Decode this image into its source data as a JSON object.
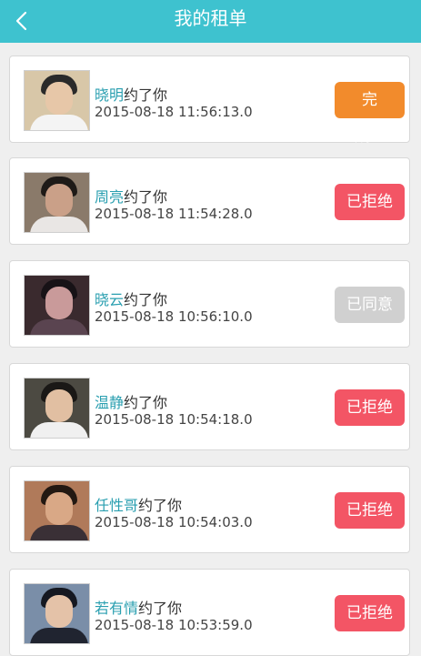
{
  "header": {
    "title": "我的租单"
  },
  "icons": {
    "back": "chevron-left-icon"
  },
  "colors": {
    "header_bg": "#3ec2cf",
    "name_text": "#2a9fb0",
    "done_button": "#f28b2c",
    "reject_button": "#f35565",
    "agree_button": "#d0d0d0"
  },
  "orders": [
    {
      "name": "晓明",
      "suffix": "约了你",
      "time": "2015-08-18 11:56:13.0",
      "status": "完成",
      "status_type": "done"
    },
    {
      "name": "周亮",
      "suffix": "约了你",
      "time": "2015-08-18 11:54:28.0",
      "status": "已拒绝",
      "status_type": "reject"
    },
    {
      "name": "晓云",
      "suffix": "约了你",
      "time": "2015-08-18 10:56:10.0",
      "status": "已同意",
      "status_type": "agree"
    },
    {
      "name": "温静",
      "suffix": "约了你",
      "time": "2015-08-18 10:54:18.0",
      "status": "已拒绝",
      "status_type": "reject"
    },
    {
      "name": "任性哥",
      "suffix": "约了你",
      "time": "2015-08-18 10:54:03.0",
      "status": "已拒绝",
      "status_type": "reject"
    },
    {
      "name": "若有情",
      "suffix": "约了你",
      "time": "2015-08-18 10:53:59.0",
      "status": "已拒绝",
      "status_type": "reject"
    }
  ]
}
